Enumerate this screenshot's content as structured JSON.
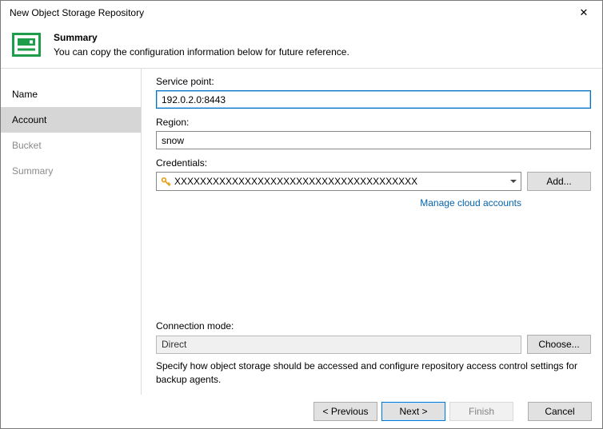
{
  "window": {
    "title": "New Object Storage Repository",
    "close_glyph": "✕"
  },
  "header": {
    "title": "Summary",
    "description": "You can copy the configuration information below for future reference."
  },
  "sidebar": {
    "items": [
      {
        "label": "Name",
        "state": "done"
      },
      {
        "label": "Account",
        "state": "selected"
      },
      {
        "label": "Bucket",
        "state": "upcoming"
      },
      {
        "label": "Summary",
        "state": "upcoming"
      }
    ]
  },
  "form": {
    "service_point_label": "Service point:",
    "service_point_value": "192.0.2.0:8443",
    "region_label": "Region:",
    "region_value": "snow",
    "credentials_label": "Credentials:",
    "credentials_value": "XXXXXXXXXXXXXXXXXXXXXXXXXXXXXXXXXXXXXX",
    "add_button": "Add...",
    "manage_link": "Manage cloud accounts",
    "connection_mode_label": "Connection mode:",
    "connection_mode_value": "Direct",
    "choose_button": "Choose...",
    "help_text": "Specify how object storage should be accessed and configure repository access control settings for backup agents."
  },
  "footer": {
    "previous": "< Previous",
    "next": "Next >",
    "finish": "Finish",
    "cancel": "Cancel"
  },
  "colors": {
    "accent_blue": "#0072c6",
    "default_button_border": "#0078d7",
    "link_blue": "#0563ad",
    "veeam_green": "#1e9e4a",
    "selected_step_bg": "#d6d6d6",
    "key_icon_gold": "#e3a21a"
  }
}
